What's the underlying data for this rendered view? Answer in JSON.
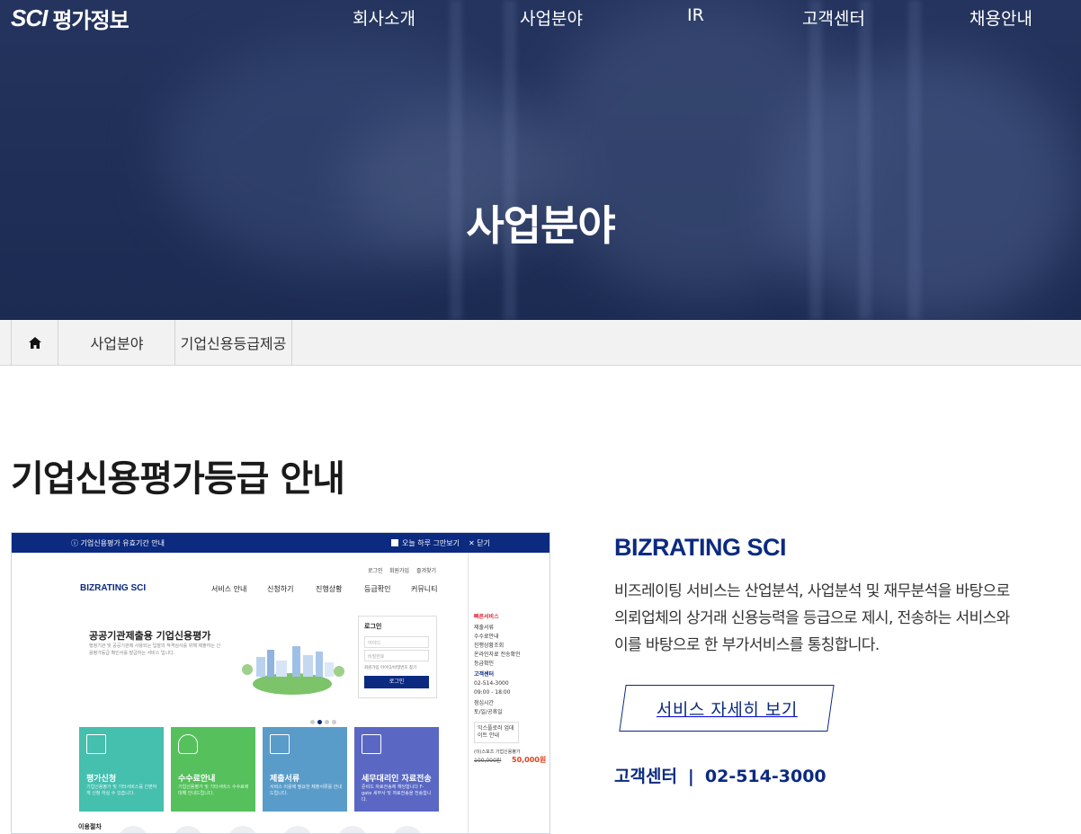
{
  "logo": {
    "sci": "SCI",
    "name": "평가정보"
  },
  "nav": [
    {
      "label": "회사소개"
    },
    {
      "label": "사업분야"
    },
    {
      "label": "IR"
    },
    {
      "label": "고객센터"
    },
    {
      "label": "채용안내"
    }
  ],
  "hero": {
    "title": "사업분야"
  },
  "breadcrumb": {
    "home_icon": "home-icon",
    "items": [
      "사업분야",
      "기업신용등급제공"
    ]
  },
  "page_title": "기업신용평가등급 안내",
  "screenshot": {
    "topbar_notice": "ⓘ 기업신용평가 유효기간 안내",
    "topbar_today": "오늘 하루 그만보기",
    "topbar_close": "✕ 닫기",
    "top_links": [
      "로그인",
      "회원가입",
      "즐겨찾기"
    ],
    "brand": "BIZRATING SCI",
    "menu": [
      "서비스 안내",
      "신청하기",
      "진행상황",
      "등급확인",
      "커뮤니티"
    ],
    "hero_title": "공공기관제출용 기업신용평가",
    "hero_desc": "행정기관 및 공공기관에 사용되는 입찰의 적격심사를 위해 제출하는 신용평가등급 확인서를 발급하는 서비스 입니다.",
    "login": {
      "title": "로그인",
      "id_placeholder": "아이디",
      "pw_placeholder": "비밀번호",
      "links": "회원가입 아이디/비밀번호 찾기",
      "button": "로그인"
    },
    "tiles": [
      {
        "title": "평가신청",
        "desc": "기업신용평가 및 기타서비스를 간편하게 신청 하실 수 있습니다.",
        "color": "#45bfae"
      },
      {
        "title": "수수료안내",
        "desc": "기업신용평가 및 기타서비스 수수료에 대해 안내드립니다.",
        "color": "#55c05c"
      },
      {
        "title": "제출서류",
        "desc": "서비스 이용에 필요한 제출서류를 안내드립니다.",
        "color": "#5a9cc9"
      },
      {
        "title": "세무대리인 자료전송",
        "desc": "준비드 자료전송에 해당합니다 F-gate 세무사 및 자료전송을 전송합니다.",
        "color": "#5a68c4"
      }
    ],
    "steps_label": "이용절차",
    "side": {
      "quick": "빠른서비스",
      "links": [
        "제출서류",
        "수수료안내",
        "진행상황조회",
        "온라인자료 전송확인",
        "등급확인"
      ],
      "cs_title": "고객센터",
      "phone": "02-514-3000",
      "hours": "09:00 - 18:00",
      "lunch": "점심시간",
      "closed": "토/일/공휴일",
      "box": "익스플로러 업데이트 안내",
      "promo": "(이)스포츠 기업신용평가",
      "old_price": "100,000원",
      "new_price": "50,000원"
    }
  },
  "info": {
    "title": "BIZRATING SCI",
    "desc_lines": [
      "비즈레이팅 서비스는 산업분석, 사업분석 및 재무분석을 바탕으로",
      "의뢰업체의 상거래 신용능력을 등급으로 제시, 전송하는 서비스와",
      "이를 바탕으로 한 부가서비스를 통칭합니다."
    ],
    "button": "서비스 자세히 보기",
    "cs_label": "고객센터",
    "cs_sep": "|",
    "cs_phone": "02-514-3000"
  },
  "colors": {
    "navy": "#0b2a80",
    "hero": "#1f2f57"
  }
}
